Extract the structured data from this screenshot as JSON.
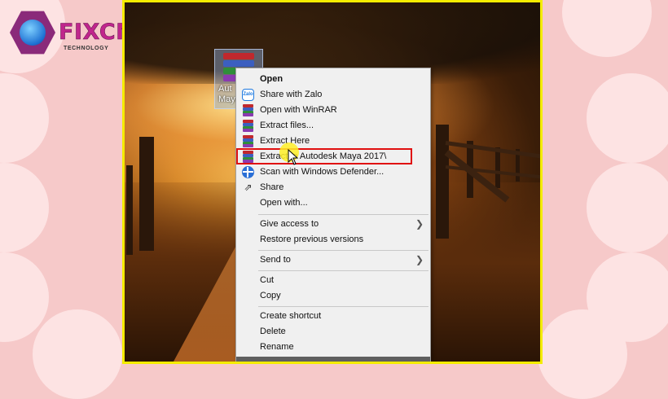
{
  "logo": {
    "brand": "FIXCNTT",
    "tagline": "TECHNOLOGY",
    "icon": "globe-hexagon-icon"
  },
  "desktop_icon": {
    "label_line1": "Aut",
    "label_line2": "Maya",
    "icon": "winrar-archive-icon"
  },
  "context_menu": {
    "items": [
      {
        "label": "Open",
        "icon": "none",
        "bold": true
      },
      {
        "label": "Share with Zalo",
        "icon": "zalo-icon"
      },
      {
        "label": "Open with WinRAR",
        "icon": "winrar-icon"
      },
      {
        "label": "Extract files...",
        "icon": "winrar-icon"
      },
      {
        "label": "Extract Here",
        "icon": "winrar-icon"
      },
      {
        "label": "Extract to Autodesk Maya 2017\\",
        "icon": "winrar-icon",
        "highlighted": true
      },
      {
        "label": "Scan with Windows Defender...",
        "icon": "windows-defender-icon"
      },
      {
        "label": "Share",
        "icon": "share-icon"
      },
      {
        "label": "Open with...",
        "icon": "none"
      },
      {
        "label": "Give access to",
        "icon": "none",
        "submenu": true
      },
      {
        "label": "Restore previous versions",
        "icon": "none"
      },
      {
        "label": "Send to",
        "icon": "none",
        "submenu": true
      },
      {
        "label": "Cut",
        "icon": "none"
      },
      {
        "label": "Copy",
        "icon": "none"
      },
      {
        "label": "Create shortcut",
        "icon": "none"
      },
      {
        "label": "Delete",
        "icon": "none"
      },
      {
        "label": "Rename",
        "icon": "none"
      }
    ]
  },
  "colors": {
    "frame_border": "#f4ec00",
    "highlight_border": "#e01010",
    "logo_brand": "#c0268c"
  }
}
